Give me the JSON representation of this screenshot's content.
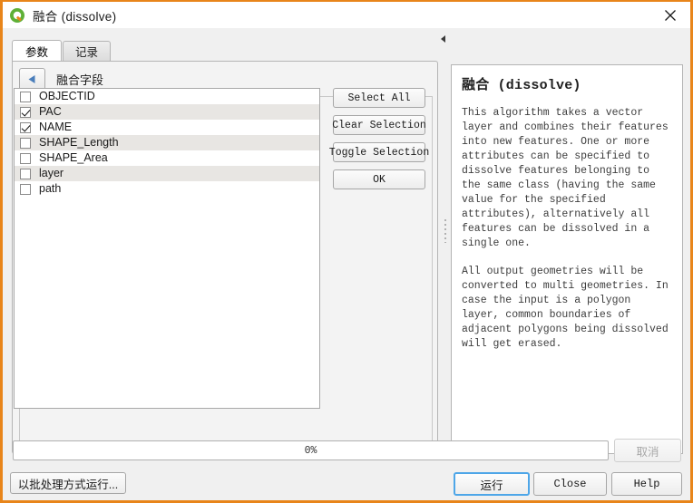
{
  "window": {
    "title": "融合 (dissolve)",
    "logo_icon": "qgis-logo-icon",
    "close_icon": "close-icon",
    "accent_border": "#e8851a"
  },
  "tabs": [
    {
      "label": "参数",
      "active": true
    },
    {
      "label": "记录",
      "active": false
    }
  ],
  "parameters": {
    "collapse_icon": "triangle-left-icon",
    "field_label": "融合字段",
    "fields": [
      {
        "name": "OBJECTID",
        "checked": false
      },
      {
        "name": "PAC",
        "checked": true
      },
      {
        "name": "NAME",
        "checked": true
      },
      {
        "name": "SHAPE_Length",
        "checked": false
      },
      {
        "name": "SHAPE_Area",
        "checked": false
      },
      {
        "name": "layer",
        "checked": false
      },
      {
        "name": "path",
        "checked": false
      }
    ],
    "buttons": [
      "Select All",
      "Clear Selection",
      "Toggle Selection",
      "OK"
    ]
  },
  "splitter": {
    "arrow_icon": "triangle-left-icon",
    "grip_icon": "splitter-grip-icon"
  },
  "help": {
    "title": "融合 (dissolve)",
    "paragraphs": [
      "This algorithm takes a vector layer and combines their features into new features. One or more attributes can be specified to dissolve features belonging to the same class (having the same value for the specified attributes), alternatively all features can be dissolved in a single one.",
      "All output geometries will be converted to multi geometries. In case the input is a polygon layer, common boundaries of adjacent polygons being dissolved will get erased."
    ]
  },
  "footer": {
    "progress_text": "0%",
    "progress_value": 0,
    "cancel_label": "取消",
    "cancel_disabled": true,
    "batch_label": "以批处理方式运行...",
    "run_label": "运行",
    "close_label": "Close",
    "help_label": "Help",
    "focus_color": "#4ea6e8"
  }
}
